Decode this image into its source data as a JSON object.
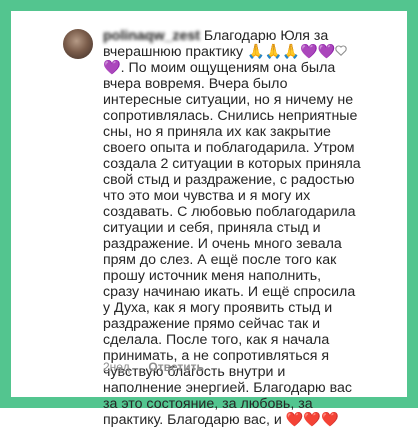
{
  "comment": {
    "username": "polinaqw_zest",
    "lines": [
      "Благодарю Юля за",
      "вчерашнюю практику",
      ". По моим ощущениям она была",
      "вчера вовремя. Вчера было",
      "интересные ситуации, но я ничему не",
      "сопротивлялась. Снились неприятные",
      "сны, но я приняла их как закрытие",
      "своего опыта и поблагодарила. Утром",
      "создала 2 ситуации в которых приняла",
      "свой стыд и раздражение, с радостью",
      "что это мои чувства и я могу их",
      "создавать. С любовью поблагодарила",
      "ситуации и себя, приняла стыд и",
      "раздражение. И очень много зевала",
      "прям до слез. А ещё после того как",
      "прошу источник меня наполнить,",
      "сразу начинаю икать. И ещё спросила",
      "у Духа, как я могу проявить стыд и",
      "раздражение прямо сейчас так и",
      "сделала. После того, как я начала",
      "принимать, а не сопротивляться я",
      "чувствую благость внутри и",
      "наполнение энергией. Благодарю вас",
      "за это состояние, за любовь, за",
      "практику. Благодарю вас, и"
    ],
    "emoji_pray": "🙏🙏🙏",
    "emoji_purple_hearts": "💜💜",
    "emoji_purple_heart_single": "💜",
    "emoji_red_hearts": "❤️❤️❤️"
  },
  "meta": {
    "time": "2нед.",
    "reply_label": "Ответить"
  },
  "colors": {
    "frame": "#53c58f",
    "text": "#262626",
    "meta": "#8e8e8e"
  },
  "icons": {
    "like": "heart-outline-icon"
  }
}
